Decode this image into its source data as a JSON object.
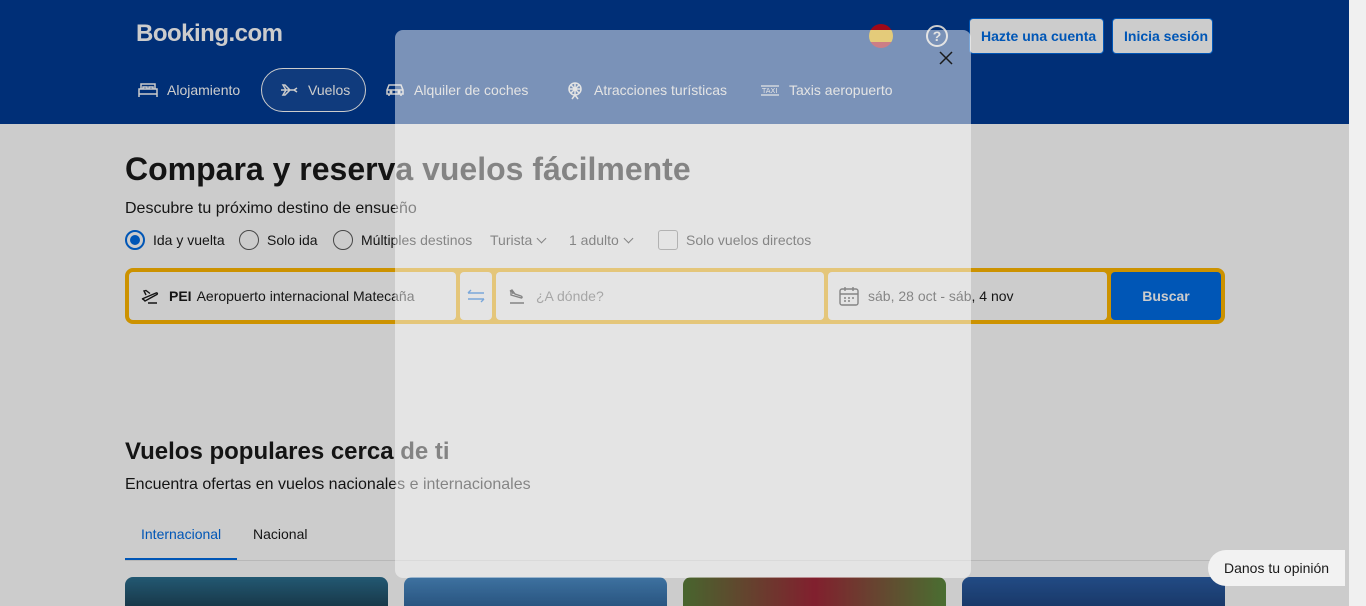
{
  "header": {
    "logo": "Booking.com",
    "help_icon_glyph": "?",
    "signup_label": "Hazte una cuenta",
    "login_label": "Inicia sesión",
    "nav": [
      {
        "label": "Alojamiento",
        "icon": "bed-icon"
      },
      {
        "label": "Vuelos",
        "icon": "plane-icon",
        "active": true
      },
      {
        "label": "Alquiler de coches",
        "icon": "car-icon"
      },
      {
        "label": "Atracciones turísticas",
        "icon": "attraction-icon"
      },
      {
        "label": "Taxis aeropuerto",
        "icon": "taxi-icon"
      }
    ]
  },
  "hero": {
    "title": "Compara y reserva vuelos fácilmente",
    "subtitle": "Descubre tu próximo destino de ensueño",
    "trip_types": [
      {
        "label": "Ida y vuelta",
        "selected": true
      },
      {
        "label": "Solo ida",
        "selected": false
      },
      {
        "label": "Múltiples destinos",
        "selected": false
      }
    ],
    "cabin_class": "Turista",
    "passengers": "1 adulto",
    "direct_only_label": "Solo vuelos directos",
    "direct_only_checked": false
  },
  "search": {
    "origin_code": "PEI",
    "origin_name": "Aeropuerto internacional Matecaña",
    "destination_placeholder": "¿A dónde?",
    "dates": "sáb, 28 oct - sáb, 4 nov",
    "submit_label": "Buscar"
  },
  "popular": {
    "title": "Vuelos populares cerca de ti",
    "subtitle": "Encuentra ofertas en vuelos nacionales e internacionales",
    "tabs": [
      {
        "label": "Internacional",
        "active": true
      },
      {
        "label": "Nacional",
        "active": false
      }
    ]
  },
  "feedback_label": "Danos tu opinión",
  "colors": {
    "brand_blue": "#003b95",
    "action_blue": "#006ce4",
    "search_border": "#ffb700"
  }
}
